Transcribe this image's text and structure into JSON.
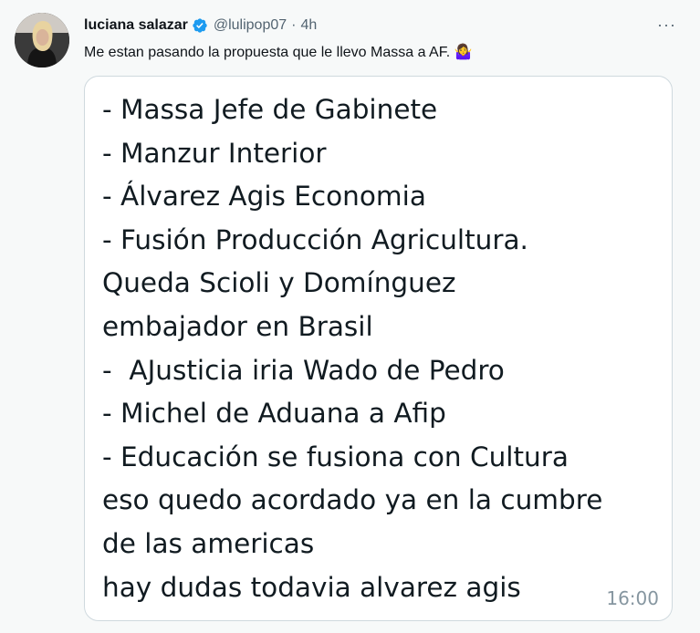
{
  "tweet": {
    "author_name": "luciana salazar",
    "handle": "@lulipop07",
    "separator": "·",
    "time": "4h",
    "more_label": "···",
    "text": "Me estan pasando la propuesta que le llevo Massa a AF. 🤷‍♀️",
    "verified_color": "#1d9bf0",
    "avatar_icon": "profile-photo"
  },
  "message": {
    "lines": [
      "- Massa Jefe de Gabinete",
      "- Manzur Interior",
      "- Álvarez Agis Economia",
      "- Fusión Producción Agricultura.",
      "Queda Scioli y Domínguez",
      "embajador en Brasil",
      "-  AJusticia iria Wado de Pedro",
      "- Michel de Aduana a Afip",
      "- Educación se fusiona con Cultura",
      "eso quedo acordado ya en la cumbre",
      "de las americas",
      "hay dudas todavia alvarez agis"
    ],
    "timestamp": "16:00"
  }
}
